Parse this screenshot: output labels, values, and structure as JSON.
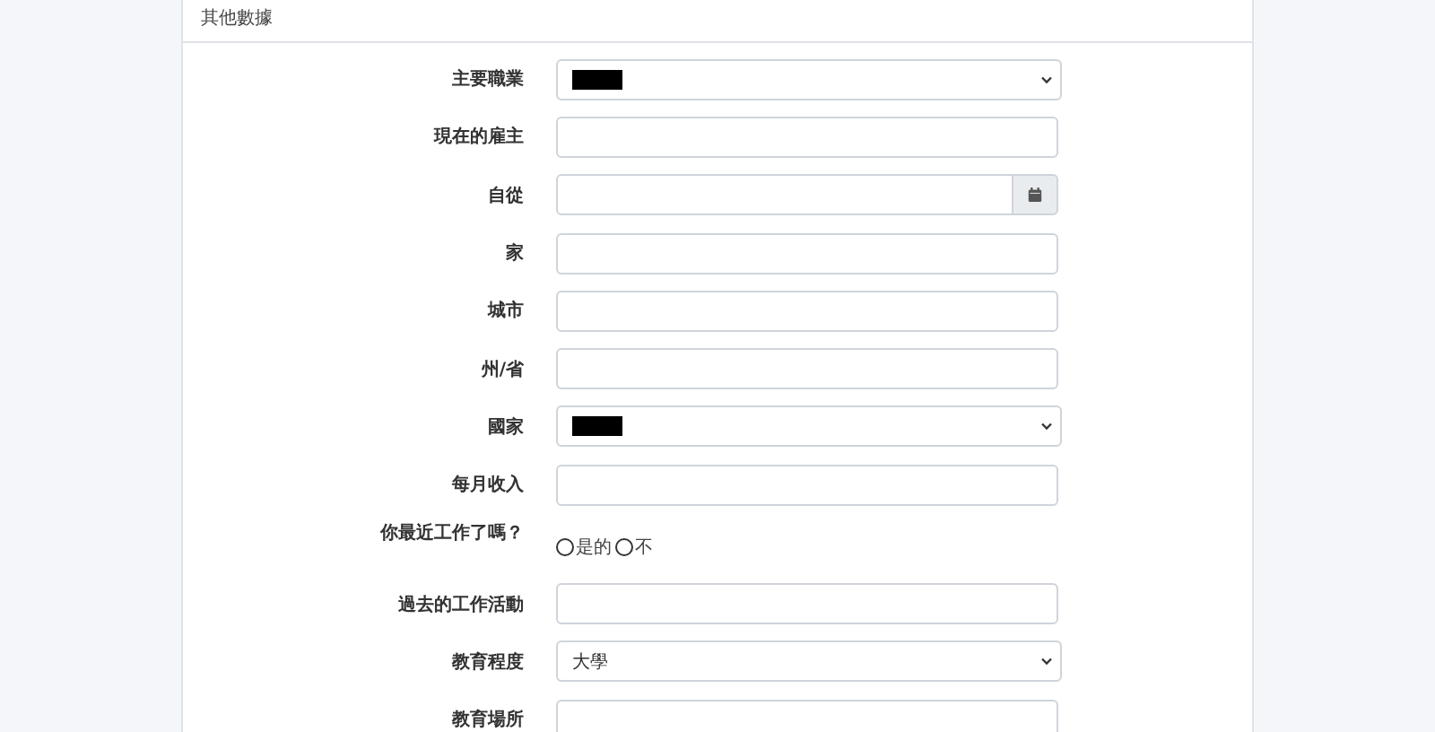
{
  "section": {
    "title": "其他數據"
  },
  "fields": [
    {
      "kind": "select",
      "label": "主要職業",
      "redacted": true
    },
    {
      "kind": "text",
      "label": "現在的雇主"
    },
    {
      "kind": "date",
      "label": "自從"
    },
    {
      "kind": "text",
      "label": "家"
    },
    {
      "kind": "text",
      "label": "城市"
    },
    {
      "kind": "text",
      "label": "州/省"
    },
    {
      "kind": "select",
      "label": "國家",
      "redacted": true
    },
    {
      "kind": "text",
      "label": "每月收入"
    },
    {
      "kind": "radio",
      "label": "你最近工作了嗎？",
      "options": [
        {
          "label": "是的",
          "selected": false
        },
        {
          "label": "不",
          "selected": false
        }
      ]
    },
    {
      "kind": "text",
      "label": "過去的工作活動"
    },
    {
      "kind": "select",
      "label": "教育程度",
      "value": "大學"
    },
    {
      "kind": "text",
      "label": "教育場所"
    }
  ]
}
